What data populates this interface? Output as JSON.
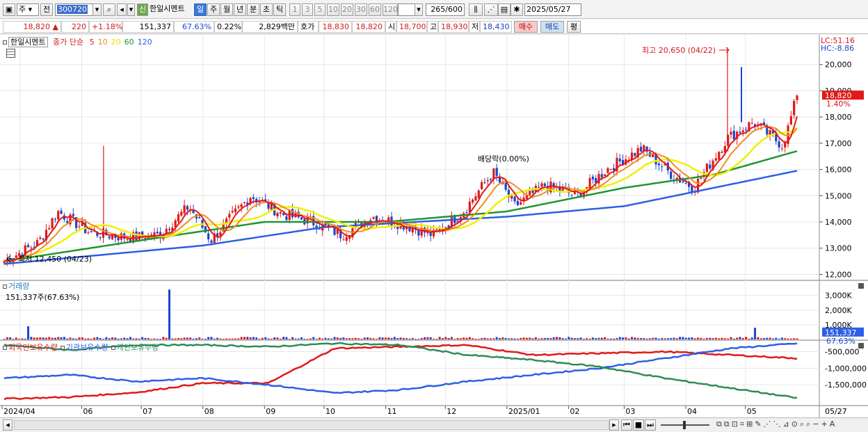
{
  "toolbar": {
    "market": "주",
    "prev": "전",
    "code": "300720",
    "credit_badge": "신",
    "stock_name": "한일시멘트",
    "periods": [
      "일",
      "주",
      "월",
      "년",
      "분",
      "초",
      "틱"
    ],
    "active_period": "일",
    "intervals": [
      "1",
      "3",
      "5",
      "10",
      "20",
      "30",
      "60",
      "120"
    ],
    "count": "265",
    "count_max": "/600",
    "date": "2025/05/27"
  },
  "quote": {
    "price": "18,820",
    "change_arrow": "▲",
    "change": "220",
    "change_pct": "+1.18%",
    "volume": "151,337",
    "volume_ratio": "67.63%",
    "turnover": "0.22%",
    "amount": "2,829백만",
    "bid_label": "호가",
    "ask1": "18,830",
    "bid1": "18,820",
    "open_label": "시",
    "open": "18,700",
    "high_label": "고",
    "high": "18,930",
    "low_label": "저",
    "low": "18,430",
    "buy_button": "매수",
    "sell_button": "매도",
    "eval_button": "평"
  },
  "price_pane": {
    "stock_name": "한일시멘트",
    "ma_title": "종가 단순",
    "ma_periods": [
      {
        "label": "5",
        "color": "#e11919"
      },
      {
        "label": "10",
        "color": "#f08c1e"
      },
      {
        "label": "20",
        "color": "#e6e600"
      },
      {
        "label": "60",
        "color": "#1e9632"
      },
      {
        "label": "120",
        "color": "#2d5fe6"
      }
    ],
    "lc": "LC:51.16",
    "hc": "HC:-8.86",
    "high_note": "최고 20,650 (04/22)",
    "low_note": "최저 12,450 (04/23)",
    "dividend_note": "배당락(0.00%)",
    "current_price": "18,820",
    "current_pct": "1.40%",
    "y_ticks": [
      "20,000",
      "19,000",
      "18,000",
      "17,000",
      "16,000",
      "15,000",
      "14,000",
      "13,000",
      "12,000"
    ]
  },
  "volume_pane": {
    "title": "거래량",
    "value_text": "151,337주(67.63%)",
    "y_ticks": [
      "3,000K",
      "2,000K",
      "1,000K"
    ],
    "current": "151,337",
    "current_pct": "67.63%"
  },
  "holding_pane": {
    "series": [
      {
        "label": "외국인보유수량",
        "color": "#e11919"
      },
      {
        "label": "기관보유수량",
        "color": "#2d5fe6"
      },
      {
        "label": "개인보유수량",
        "color": "#2e8b57"
      }
    ],
    "y_ticks": [
      "-500,000",
      "-1,000,000",
      "-1,500,000"
    ]
  },
  "x_axis": {
    "labels": [
      "2024/04",
      "06",
      "07",
      "08",
      "09",
      "10",
      "11",
      "12",
      "2025/01",
      "02",
      "03",
      "04",
      "05"
    ],
    "end_label": "05/27"
  },
  "colors": {
    "up": "#e11919",
    "down": "#1b45d1",
    "ma5": "#e11919",
    "ma10": "#f08c1e",
    "ma20": "#f0f000",
    "ma60": "#1e9632",
    "ma120": "#2d5fe6",
    "grid": "#e6e6e6"
  },
  "chart_data": {
    "type": "candlestick",
    "title": "",
    "ylim": [
      11800,
      21000
    ],
    "x_range": [
      "2024/04",
      "2025/05/27"
    ],
    "price_keyframes": [
      {
        "date": "2024/04/23",
        "close": 12500
      },
      {
        "date": "2024/05/10",
        "close": 13200
      },
      {
        "date": "2024/05/20",
        "close": 14400
      },
      {
        "date": "2024/06/05",
        "close": 13600
      },
      {
        "date": "2024/06/25",
        "close": 13400
      },
      {
        "date": "2024/07/10",
        "close": 13500
      },
      {
        "date": "2024/07/25",
        "close": 14600
      },
      {
        "date": "2024/08/05",
        "close": 13300
      },
      {
        "date": "2024/08/25",
        "close": 15000
      },
      {
        "date": "2024/09/10",
        "close": 14300
      },
      {
        "date": "2024/09/25",
        "close": 14000
      },
      {
        "date": "2024/10/10",
        "close": 13500
      },
      {
        "date": "2024/10/25",
        "close": 14200
      },
      {
        "date": "2024/11/10",
        "close": 13900
      },
      {
        "date": "2024/11/25",
        "close": 13500
      },
      {
        "date": "2024/12/10",
        "close": 14400
      },
      {
        "date": "2024/12/25",
        "close": 15900
      },
      {
        "date": "2025/01/05",
        "close": 14600
      },
      {
        "date": "2025/01/20",
        "close": 15400
      },
      {
        "date": "2025/02/05",
        "close": 15000
      },
      {
        "date": "2025/02/20",
        "close": 16000
      },
      {
        "date": "2025/03/10",
        "close": 16800
      },
      {
        "date": "2025/03/25",
        "close": 15800
      },
      {
        "date": "2025/04/05",
        "close": 15300
      },
      {
        "date": "2025/04/22",
        "close": 17200
      },
      {
        "date": "2025/05/05",
        "close": 17800
      },
      {
        "date": "2025/05/20",
        "close": 16900
      },
      {
        "date": "2025/05/27",
        "close": 18820
      }
    ],
    "ma120_keyframes": [
      {
        "date": "2024/04/23",
        "value": 12400
      },
      {
        "date": "2024/08/01",
        "value": 13100
      },
      {
        "date": "2024/10/01",
        "value": 13800
      },
      {
        "date": "2025/01/01",
        "value": 14200
      },
      {
        "date": "2025/03/01",
        "value": 14600
      },
      {
        "date": "2025/05/27",
        "value": 15950
      }
    ],
    "ma60_keyframes": [
      {
        "date": "2024/04/23",
        "value": 12500
      },
      {
        "date": "2024/07/01",
        "value": 13300
      },
      {
        "date": "2024/09/01",
        "value": 14000
      },
      {
        "date": "2024/11/01",
        "value": 14000
      },
      {
        "date": "2025/01/01",
        "value": 14400
      },
      {
        "date": "2025/03/01",
        "value": 15300
      },
      {
        "date": "2025/04/15",
        "value": 15800
      },
      {
        "date": "2025/05/27",
        "value": 16700
      }
    ],
    "holdings_keyframes": {
      "foreign": [
        -1920000,
        -1870000,
        -1730000,
        -1450000,
        -1450000,
        -400000,
        -350000,
        -300000,
        -600000,
        -550000,
        -500000,
        -600000,
        -700000
      ],
      "institution": [
        -1300000,
        -1200000,
        -1400000,
        -1300000,
        -1500000,
        -1750000,
        -1650000,
        -1400000,
        -1200000,
        -1000000,
        -700000,
        -400000,
        -250000
      ],
      "individual": [
        -300000,
        -450000,
        -300000,
        -300000,
        -350000,
        -250000,
        -300000,
        -600000,
        -750000,
        -950000,
        -1300000,
        -1600000,
        -1900000
      ]
    },
    "spike_high": {
      "date": "2025/04/22",
      "value": 20650
    },
    "spike_low": {
      "date": "2024/04/23",
      "value": 12450
    }
  }
}
